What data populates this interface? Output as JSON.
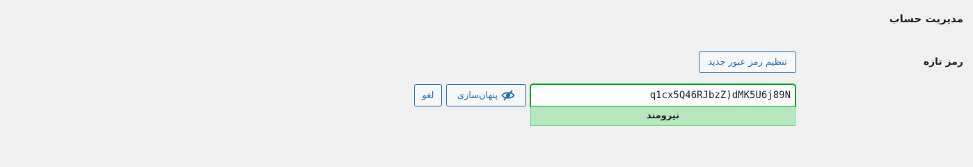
{
  "section": {
    "title": "مدیریت حساب"
  },
  "new_password": {
    "label": "رمز تازه",
    "set_button_label": "تنظیم رمز عبور جدید",
    "input_value": "q1cx5Q46RJbzZ)dMK5U6j89N",
    "strength_label": "نیرومند",
    "hide_button_label": "پنهان‌سازی",
    "hide_button_icon": "eye-slash-icon",
    "cancel_button_label": "لغو"
  },
  "colors": {
    "accent": "#2271b1",
    "strength_bg": "#b8e6bf",
    "strength_border": "#68de7c",
    "input_border": "#00a32a",
    "background": "#f0f0f1"
  }
}
